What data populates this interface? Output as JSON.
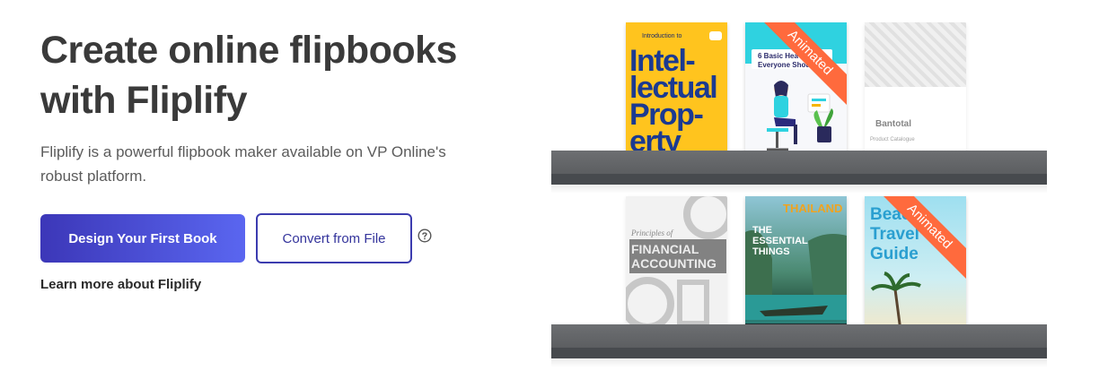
{
  "hero": {
    "headline": "Create online flipbooks with Fliplify",
    "subtitle": "Fliplify is a powerful flipbook maker available on VP Online's robust platform.",
    "primary_button": "Design Your First Book",
    "secondary_button": "Convert from File",
    "learn_more": "Learn more about Fliplify"
  },
  "icons": {
    "help": "question-circle-icon"
  },
  "colors": {
    "primary_start": "#3c37b8",
    "primary_end": "#5a66f0",
    "outline": "#3c3caf",
    "ribbon": "#ff6a3d",
    "shelf": "#5f6164"
  },
  "books": [
    {
      "intro": "Introduction to",
      "title": "Intel-lectual Prop-erty",
      "line1": "Intel-",
      "line2": "lectual",
      "line3": "Prop-",
      "line4": "erty"
    },
    {
      "title": "6 Basic Hea... Everyone Should...",
      "line1": "6 Basic Hea",
      "line2": "Everyone Should",
      "ribbon": "Animated"
    },
    {
      "brand": "Bantotal",
      "subtitle": "Product Catalogue"
    },
    {
      "prefix": "Principles of",
      "line1": "FINANCIAL",
      "line2": "ACCOUNTING"
    },
    {
      "title": "THAILAND",
      "line1": "THE",
      "line2": "ESSENTIAL",
      "line3": "THINGS"
    },
    {
      "line1": "Beach",
      "line2": "Travel",
      "line3": "Guide",
      "ribbon": "Animated"
    }
  ]
}
